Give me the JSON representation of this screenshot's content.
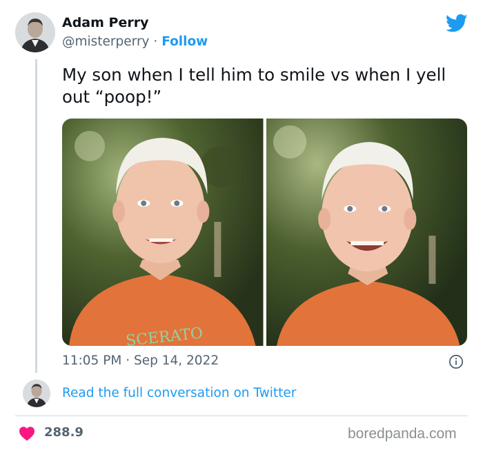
{
  "tweet": {
    "author_name": "Adam Perry",
    "handle": "@misterperry",
    "separator": "·",
    "follow_label": "Follow",
    "text": "My son when I tell him to smile vs when I yell out “poop!”",
    "timestamp": "11:05 PM · Sep 14, 2022",
    "read_more_label": "Read the full conversation on Twitter",
    "likes_count": "288.9",
    "shirt_text": "SCERATO"
  },
  "source_watermark": "boredpanda.com",
  "colors": {
    "twitter_blue": "#1d9bf0",
    "heart": "#f91880",
    "text_primary": "#0f1419",
    "text_secondary": "#536471"
  },
  "icons": [
    "twitter-bird-icon",
    "info-icon",
    "heart-icon"
  ]
}
